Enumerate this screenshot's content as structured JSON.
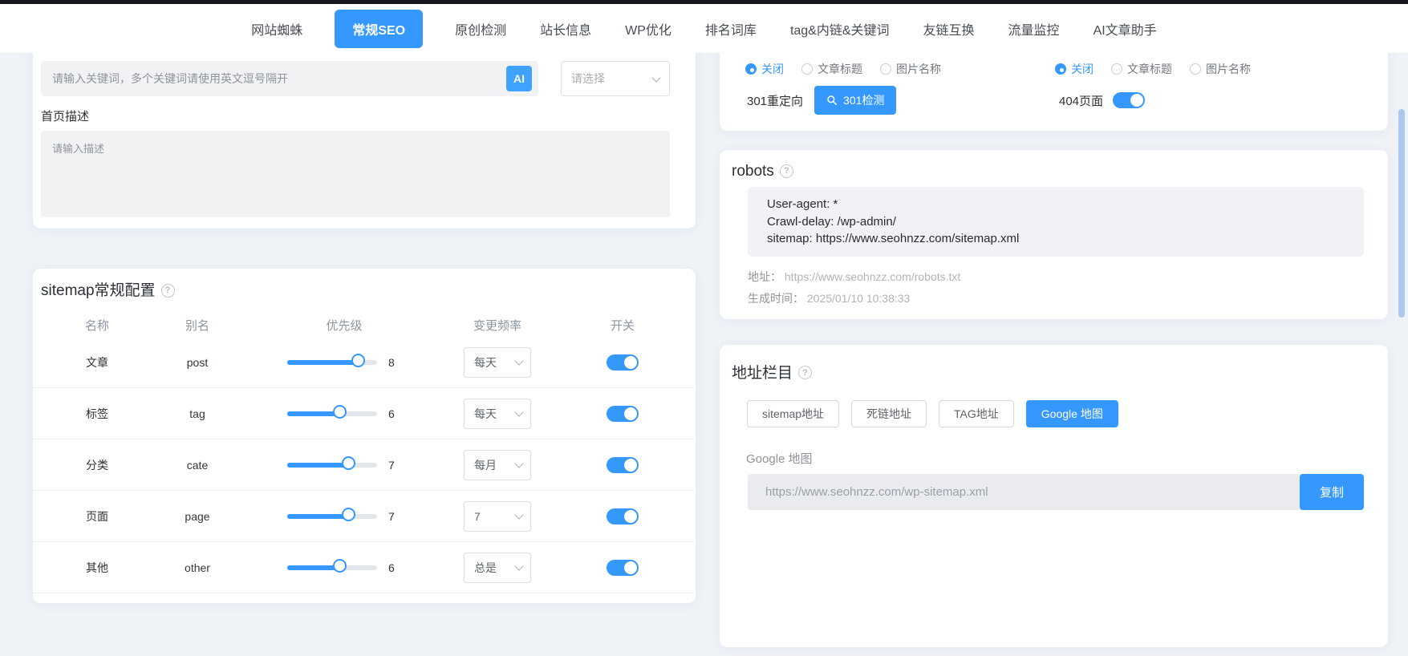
{
  "colors": {
    "accent": "#3598fe",
    "page_bg": "#eff2f7"
  },
  "icons": {
    "help": "?",
    "search": "magnifier",
    "chevron": "v",
    "ai_badge": "AI"
  },
  "nav": {
    "tabs": [
      {
        "label": "网站蜘蛛",
        "active": false
      },
      {
        "label": "常规SEO",
        "active": true
      },
      {
        "label": "原创检测",
        "active": false
      },
      {
        "label": "站长信息",
        "active": false
      },
      {
        "label": "WP优化",
        "active": false
      },
      {
        "label": "排名词库",
        "active": false
      },
      {
        "label": "tag&内链&关键词",
        "active": false
      },
      {
        "label": "友链互换",
        "active": false
      },
      {
        "label": "流量监控",
        "active": false
      },
      {
        "label": "AI文章助手",
        "active": false
      }
    ]
  },
  "keywords_card": {
    "input_placeholder": "请输入关键词，多个关键词请使用英文逗号隔开",
    "ai_button": "AI",
    "select_placeholder": "请选择",
    "description_label": "首页描述",
    "description_placeholder": "请输入描述"
  },
  "sitemap_card": {
    "title": "sitemap常规配置",
    "columns": {
      "name": "名称",
      "alias": "别名",
      "priority": "优先级",
      "frequency": "变更频率",
      "switch": "开关"
    },
    "rows": [
      {
        "name": "文章",
        "alias": "post",
        "priority": 8,
        "frequency": "每天",
        "enabled": true
      },
      {
        "name": "标签",
        "alias": "tag",
        "priority": 6,
        "frequency": "每天",
        "enabled": true
      },
      {
        "name": "分类",
        "alias": "cate",
        "priority": 7,
        "frequency": "每月",
        "enabled": true
      },
      {
        "name": "页面",
        "alias": "page",
        "priority": 7,
        "frequency": "7",
        "enabled": true
      },
      {
        "name": "其他",
        "alias": "other",
        "priority": 6,
        "frequency": "总是",
        "enabled": true
      }
    ]
  },
  "redirect_card": {
    "radio_groups": [
      {
        "options": [
          {
            "label": "关闭",
            "selected": true
          },
          {
            "label": "文章标题",
            "selected": false
          },
          {
            "label": "图片名称",
            "selected": false
          }
        ]
      },
      {
        "options": [
          {
            "label": "关闭",
            "selected": true
          },
          {
            "label": "文章标题",
            "selected": false
          },
          {
            "label": "图片名称",
            "selected": false
          }
        ]
      }
    ],
    "redirect_label": "301重定向",
    "check_button": "301检测",
    "page404_label": "404页面",
    "page404_enabled": true
  },
  "robots_card": {
    "title": "robots",
    "content_lines": [
      "User-agent: *",
      "Crawl-delay: /wp-admin/",
      "sitemap: https://www.seohnzz.com/sitemap.xml"
    ],
    "address_label": "地址：",
    "address_value": "https://www.seohnzz.com/robots.txt",
    "generated_label": "生成时间：",
    "generated_value": "2025/01/10 10:38:33"
  },
  "address_card": {
    "title": "地址栏目",
    "buttons": [
      {
        "label": "sitemap地址",
        "active": false
      },
      {
        "label": "死链地址",
        "active": false
      },
      {
        "label": "TAG地址",
        "active": false
      },
      {
        "label": "Google 地图",
        "active": true
      }
    ],
    "section_label": "Google 地图",
    "url": "https://www.seohnzz.com/wp-sitemap.xml",
    "copy_button": "复制"
  }
}
